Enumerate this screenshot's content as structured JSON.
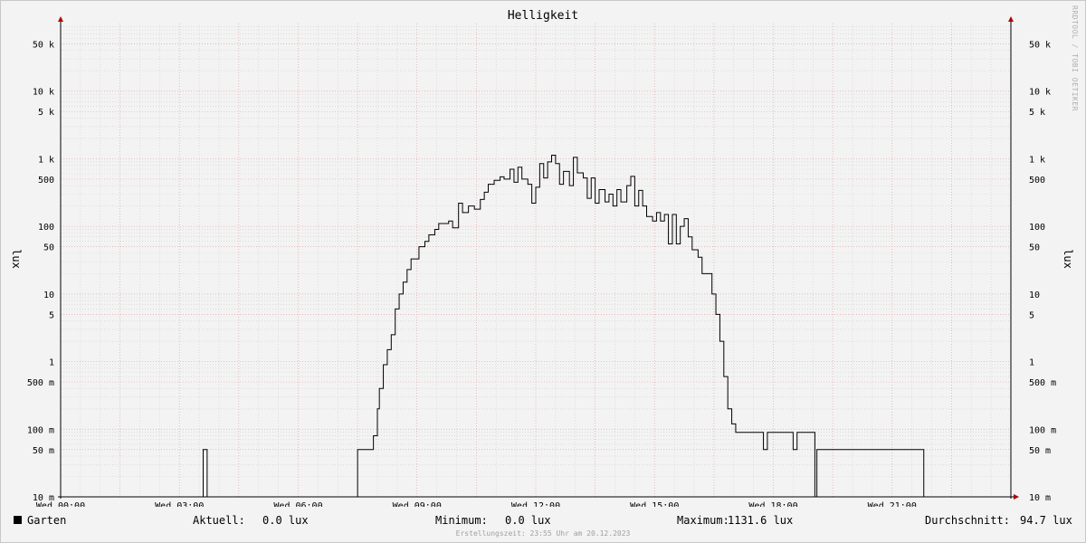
{
  "title": "Helligkeit",
  "watermark": "RRDTOOL / TOBI OETIKER",
  "footer": "Erstellungszeit: 23:55 Uhr am 20.12.2023",
  "legend": {
    "series_name": "Garten",
    "current_label": "Aktuell:",
    "current_value": "0.0 lux",
    "min_label": "Minimum:",
    "min_value": "0.0 lux",
    "max_label": "Maximum:",
    "max_value": "1131.6 lux",
    "avg_label": "Durchschnitt:",
    "avg_value": "94.7 lux"
  },
  "colors": {
    "line": "#000000",
    "major_grid": "#e8a3a3",
    "minor_grid": "#d0d0d0",
    "axis": "#b00000"
  },
  "chart_data": {
    "type": "line",
    "title": "Helligkeit",
    "ylabel": "lux",
    "ylabel_right": "lux",
    "yscale": "log",
    "ylim": [
      0.01,
      100000
    ],
    "xlim": [
      0,
      24
    ],
    "xlabel": "",
    "grid": true,
    "x_ticks": [
      {
        "x": 0,
        "label": "Wed 00:00"
      },
      {
        "x": 3,
        "label": "Wed 03:00"
      },
      {
        "x": 6,
        "label": "Wed 06:00"
      },
      {
        "x": 9,
        "label": "Wed 09:00"
      },
      {
        "x": 12,
        "label": "Wed 12:00"
      },
      {
        "x": 15,
        "label": "Wed 15:00"
      },
      {
        "x": 18,
        "label": "Wed 18:00"
      },
      {
        "x": 21,
        "label": "Wed 21:00"
      }
    ],
    "y_ticks": [
      {
        "y": 0.01,
        "label": "10 m"
      },
      {
        "y": 0.05,
        "label": "50 m"
      },
      {
        "y": 0.1,
        "label": "100 m"
      },
      {
        "y": 0.5,
        "label": "500 m"
      },
      {
        "y": 1,
        "label": "1"
      },
      {
        "y": 5,
        "label": "5"
      },
      {
        "y": 10,
        "label": "10"
      },
      {
        "y": 50,
        "label": "50"
      },
      {
        "y": 100,
        "label": "100"
      },
      {
        "y": 500,
        "label": "500"
      },
      {
        "y": 1000,
        "label": "1 k"
      },
      {
        "y": 5000,
        "label": "5 k"
      },
      {
        "y": 10000,
        "label": "10 k"
      },
      {
        "y": 50000,
        "label": "50 k"
      }
    ],
    "series": [
      {
        "name": "Garten",
        "points": [
          [
            0,
            0.01
          ],
          [
            3.6,
            0.01
          ],
          [
            3.6,
            0.05
          ],
          [
            3.7,
            0.05
          ],
          [
            3.7,
            0.01
          ],
          [
            7.5,
            0.01
          ],
          [
            7.5,
            0.05
          ],
          [
            7.9,
            0.05
          ],
          [
            7.9,
            0.08
          ],
          [
            8.0,
            0.08
          ],
          [
            8.0,
            0.2
          ],
          [
            8.05,
            0.2
          ],
          [
            8.05,
            0.4
          ],
          [
            8.15,
            0.4
          ],
          [
            8.15,
            0.9
          ],
          [
            8.25,
            0.9
          ],
          [
            8.25,
            1.5
          ],
          [
            8.35,
            1.5
          ],
          [
            8.35,
            2.5
          ],
          [
            8.45,
            2.5
          ],
          [
            8.45,
            6
          ],
          [
            8.55,
            6
          ],
          [
            8.55,
            10
          ],
          [
            8.65,
            10
          ],
          [
            8.65,
            15
          ],
          [
            8.75,
            15
          ],
          [
            8.75,
            23
          ],
          [
            8.85,
            23
          ],
          [
            8.85,
            33
          ],
          [
            9.05,
            33
          ],
          [
            9.05,
            50
          ],
          [
            9.2,
            50
          ],
          [
            9.2,
            60
          ],
          [
            9.3,
            60
          ],
          [
            9.3,
            75
          ],
          [
            9.45,
            75
          ],
          [
            9.45,
            90
          ],
          [
            9.55,
            90
          ],
          [
            9.55,
            110
          ],
          [
            9.8,
            110
          ],
          [
            9.8,
            120
          ],
          [
            9.9,
            120
          ],
          [
            9.9,
            95
          ],
          [
            10.05,
            95
          ],
          [
            10.05,
            220
          ],
          [
            10.15,
            220
          ],
          [
            10.15,
            160
          ],
          [
            10.3,
            160
          ],
          [
            10.3,
            200
          ],
          [
            10.45,
            200
          ],
          [
            10.45,
            180
          ],
          [
            10.6,
            180
          ],
          [
            10.6,
            250
          ],
          [
            10.7,
            250
          ],
          [
            10.7,
            320
          ],
          [
            10.8,
            320
          ],
          [
            10.8,
            420
          ],
          [
            10.95,
            420
          ],
          [
            10.95,
            480
          ],
          [
            11.1,
            480
          ],
          [
            11.1,
            540
          ],
          [
            11.2,
            540
          ],
          [
            11.2,
            500
          ],
          [
            11.35,
            500
          ],
          [
            11.35,
            700
          ],
          [
            11.45,
            700
          ],
          [
            11.45,
            450
          ],
          [
            11.55,
            450
          ],
          [
            11.55,
            750
          ],
          [
            11.65,
            750
          ],
          [
            11.65,
            500
          ],
          [
            11.8,
            500
          ],
          [
            11.8,
            420
          ],
          [
            11.9,
            420
          ],
          [
            11.9,
            220
          ],
          [
            12.0,
            220
          ],
          [
            12.0,
            380
          ],
          [
            12.1,
            380
          ],
          [
            12.1,
            850
          ],
          [
            12.2,
            850
          ],
          [
            12.2,
            520
          ],
          [
            12.3,
            520
          ],
          [
            12.3,
            900
          ],
          [
            12.4,
            900
          ],
          [
            12.4,
            1130
          ],
          [
            12.5,
            1130
          ],
          [
            12.5,
            850
          ],
          [
            12.6,
            850
          ],
          [
            12.6,
            420
          ],
          [
            12.7,
            420
          ],
          [
            12.7,
            650
          ],
          [
            12.85,
            650
          ],
          [
            12.85,
            400
          ],
          [
            12.95,
            400
          ],
          [
            12.95,
            1050
          ],
          [
            13.05,
            1050
          ],
          [
            13.05,
            620
          ],
          [
            13.2,
            620
          ],
          [
            13.2,
            520
          ],
          [
            13.3,
            520
          ],
          [
            13.3,
            260
          ],
          [
            13.4,
            260
          ],
          [
            13.4,
            520
          ],
          [
            13.5,
            520
          ],
          [
            13.5,
            220
          ],
          [
            13.6,
            220
          ],
          [
            13.6,
            350
          ],
          [
            13.75,
            350
          ],
          [
            13.75,
            230
          ],
          [
            13.85,
            230
          ],
          [
            13.85,
            300
          ],
          [
            13.95,
            300
          ],
          [
            13.95,
            200
          ],
          [
            14.05,
            200
          ],
          [
            14.05,
            350
          ],
          [
            14.15,
            350
          ],
          [
            14.15,
            230
          ],
          [
            14.3,
            230
          ],
          [
            14.3,
            400
          ],
          [
            14.4,
            400
          ],
          [
            14.4,
            550
          ],
          [
            14.5,
            550
          ],
          [
            14.5,
            200
          ],
          [
            14.6,
            200
          ],
          [
            14.6,
            340
          ],
          [
            14.7,
            340
          ],
          [
            14.7,
            200
          ],
          [
            14.8,
            200
          ],
          [
            14.8,
            140
          ],
          [
            14.95,
            140
          ],
          [
            14.95,
            120
          ],
          [
            15.05,
            120
          ],
          [
            15.05,
            160
          ],
          [
            15.15,
            160
          ],
          [
            15.15,
            120
          ],
          [
            15.25,
            120
          ],
          [
            15.25,
            150
          ],
          [
            15.35,
            150
          ],
          [
            15.35,
            55
          ],
          [
            15.45,
            55
          ],
          [
            15.45,
            150
          ],
          [
            15.55,
            150
          ],
          [
            15.55,
            55
          ],
          [
            15.65,
            55
          ],
          [
            15.65,
            100
          ],
          [
            15.75,
            100
          ],
          [
            15.75,
            130
          ],
          [
            15.85,
            130
          ],
          [
            15.85,
            70
          ],
          [
            15.95,
            70
          ],
          [
            15.95,
            45
          ],
          [
            16.1,
            45
          ],
          [
            16.1,
            35
          ],
          [
            16.2,
            35
          ],
          [
            16.2,
            20
          ],
          [
            16.45,
            20
          ],
          [
            16.45,
            10
          ],
          [
            16.55,
            10
          ],
          [
            16.55,
            5
          ],
          [
            16.65,
            5
          ],
          [
            16.65,
            2
          ],
          [
            16.75,
            2
          ],
          [
            16.75,
            0.6
          ],
          [
            16.85,
            0.6
          ],
          [
            16.85,
            0.2
          ],
          [
            16.95,
            0.2
          ],
          [
            16.95,
            0.12
          ],
          [
            17.05,
            0.12
          ],
          [
            17.05,
            0.09
          ],
          [
            17.75,
            0.09
          ],
          [
            17.75,
            0.05
          ],
          [
            17.85,
            0.05
          ],
          [
            17.85,
            0.09
          ],
          [
            18.5,
            0.09
          ],
          [
            18.5,
            0.05
          ],
          [
            18.6,
            0.05
          ],
          [
            18.6,
            0.09
          ],
          [
            19.05,
            0.09
          ],
          [
            19.05,
            0.01
          ],
          [
            19.1,
            0.01
          ],
          [
            19.1,
            0.05
          ],
          [
            21.8,
            0.05
          ],
          [
            21.8,
            0.01
          ],
          [
            24,
            0.01
          ]
        ]
      }
    ]
  }
}
